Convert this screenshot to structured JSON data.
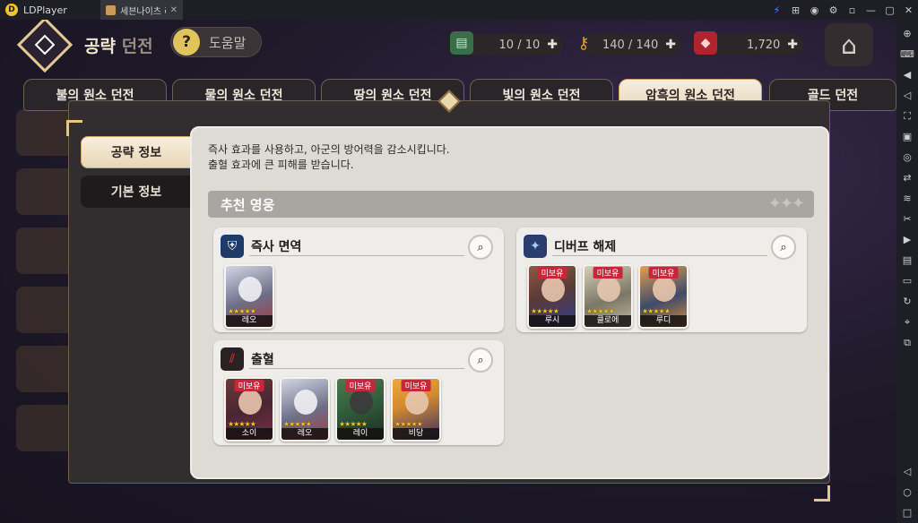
{
  "emulator": {
    "app_name": "LDPlayer",
    "tab_title": "세븐나이츠 리..."
  },
  "header": {
    "title_main": "공략",
    "title_sub": "던전",
    "help_label": "도움말",
    "resources": [
      {
        "name": "ticket",
        "value": "10 / 10",
        "color": "#3a6e4a"
      },
      {
        "name": "key",
        "value": "140 / 140",
        "color": "#b8862a"
      },
      {
        "name": "ruby",
        "value": "1,720",
        "color": "#b0242f"
      }
    ]
  },
  "dungeon_tabs": [
    {
      "label": "불의 원소 던전",
      "active": false
    },
    {
      "label": "물의 원소 던전",
      "active": false
    },
    {
      "label": "땅의 원소 던전",
      "active": false
    },
    {
      "label": "빛의 원소 던전",
      "active": false
    },
    {
      "label": "암흑의 원소 던전",
      "active": true
    },
    {
      "label": "골드 던전",
      "active": false
    }
  ],
  "left_tabs": [
    {
      "label": "공략 정보",
      "active": true
    },
    {
      "label": "기본 정보",
      "active": false
    }
  ],
  "description": [
    "즉사 효과를 사용하고, 아군의 방어력을 감소시킵니다.",
    "출혈 효과에 큰 피해를 받습니다."
  ],
  "section_title": "추천 영웅",
  "cards": [
    {
      "title": "즉사 면역",
      "icon": "shield-lock-icon",
      "heroes": [
        {
          "name": "레오",
          "badge": "",
          "colors": [
            "#6d6f87",
            "#a33a46"
          ]
        }
      ]
    },
    {
      "title": "디버프 해제",
      "icon": "sparkle-icon",
      "heroes": [
        {
          "name": "루시",
          "badge": "미보유",
          "colors": [
            "#5b3a36",
            "#2f3c8e"
          ]
        },
        {
          "name": "클로에",
          "badge": "미보유",
          "colors": [
            "#7b7765",
            "#c3b9a2"
          ]
        },
        {
          "name": "루디",
          "badge": "미보유",
          "colors": [
            "#3f4a6b",
            "#d78d3a"
          ]
        }
      ]
    },
    {
      "title": "출혈",
      "icon": "claw-icon",
      "heroes": [
        {
          "name": "소이",
          "badge": "미보유",
          "colors": [
            "#4a2632",
            "#7a2e46"
          ]
        },
        {
          "name": "레오",
          "badge": "",
          "colors": [
            "#6d6f87",
            "#a33a46"
          ]
        },
        {
          "name": "레이",
          "badge": "미보유",
          "colors": [
            "#2f5a3a",
            "#1e2a22"
          ]
        },
        {
          "name": "비당",
          "badge": "미보유",
          "colors": [
            "#d18a2e",
            "#3a2f6a"
          ]
        }
      ]
    }
  ]
}
